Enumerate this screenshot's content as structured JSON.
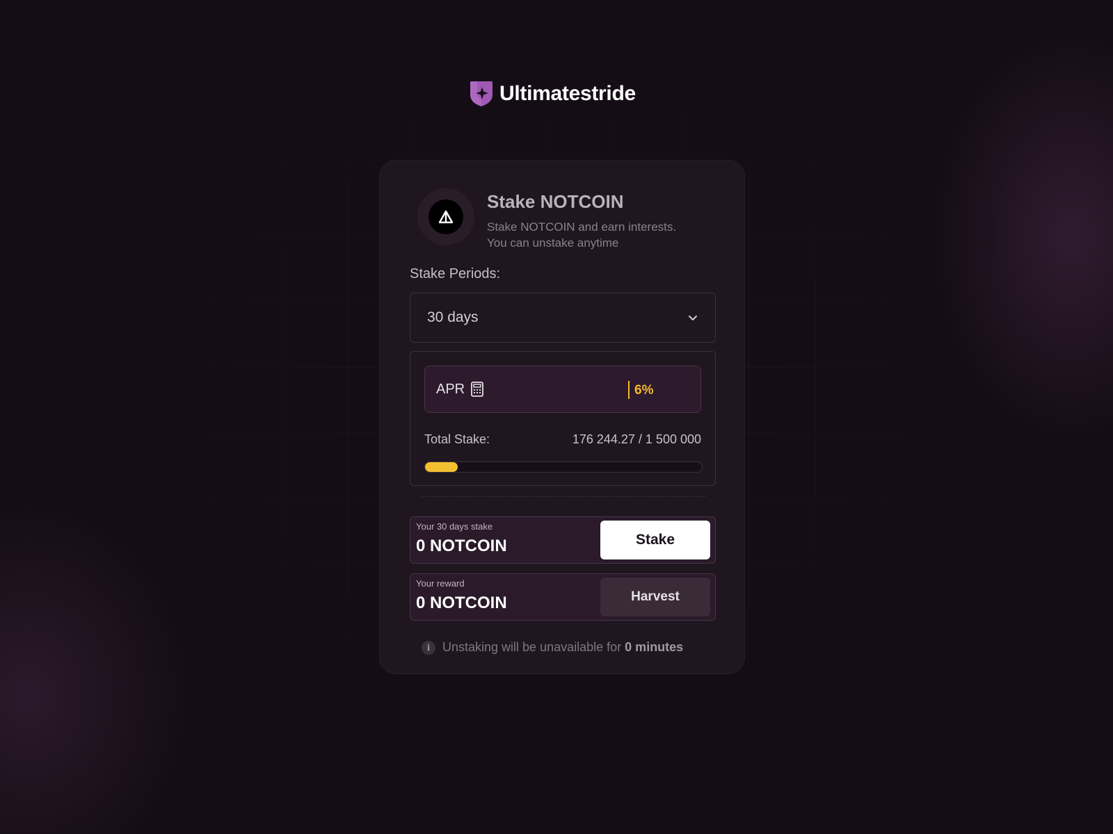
{
  "brand": {
    "name": "Ultimatestride",
    "logo_icon": "shield-star-icon",
    "logo_color": "#a05ab4"
  },
  "card": {
    "token_icon": "triangle-token-icon",
    "title": "Stake NOTCOIN",
    "subtitle_line1": "Stake NOTCOIN and earn interests.",
    "subtitle_line2": "You can unstake anytime"
  },
  "periods": {
    "label": "Stake Periods:",
    "selected": "30 days",
    "icon": "chevron-down-icon"
  },
  "apr": {
    "label": "APR",
    "icon": "calculator-icon",
    "value": "6%",
    "accent": "#f5b82e"
  },
  "total_stake": {
    "label": "Total Stake:",
    "value": "176 244.27 / 1 500 000",
    "progress_fraction": 0.1175
  },
  "stake_row": {
    "label": "Your 30 days stake",
    "amount": "0 NOTCOIN",
    "button": "Stake"
  },
  "reward_row": {
    "label": "Your reward",
    "amount": "0 NOTCOIN",
    "button": "Harvest"
  },
  "notice": {
    "icon": "info-icon",
    "text": "Unstaking will be unavailable for",
    "duration": "0 minutes"
  }
}
